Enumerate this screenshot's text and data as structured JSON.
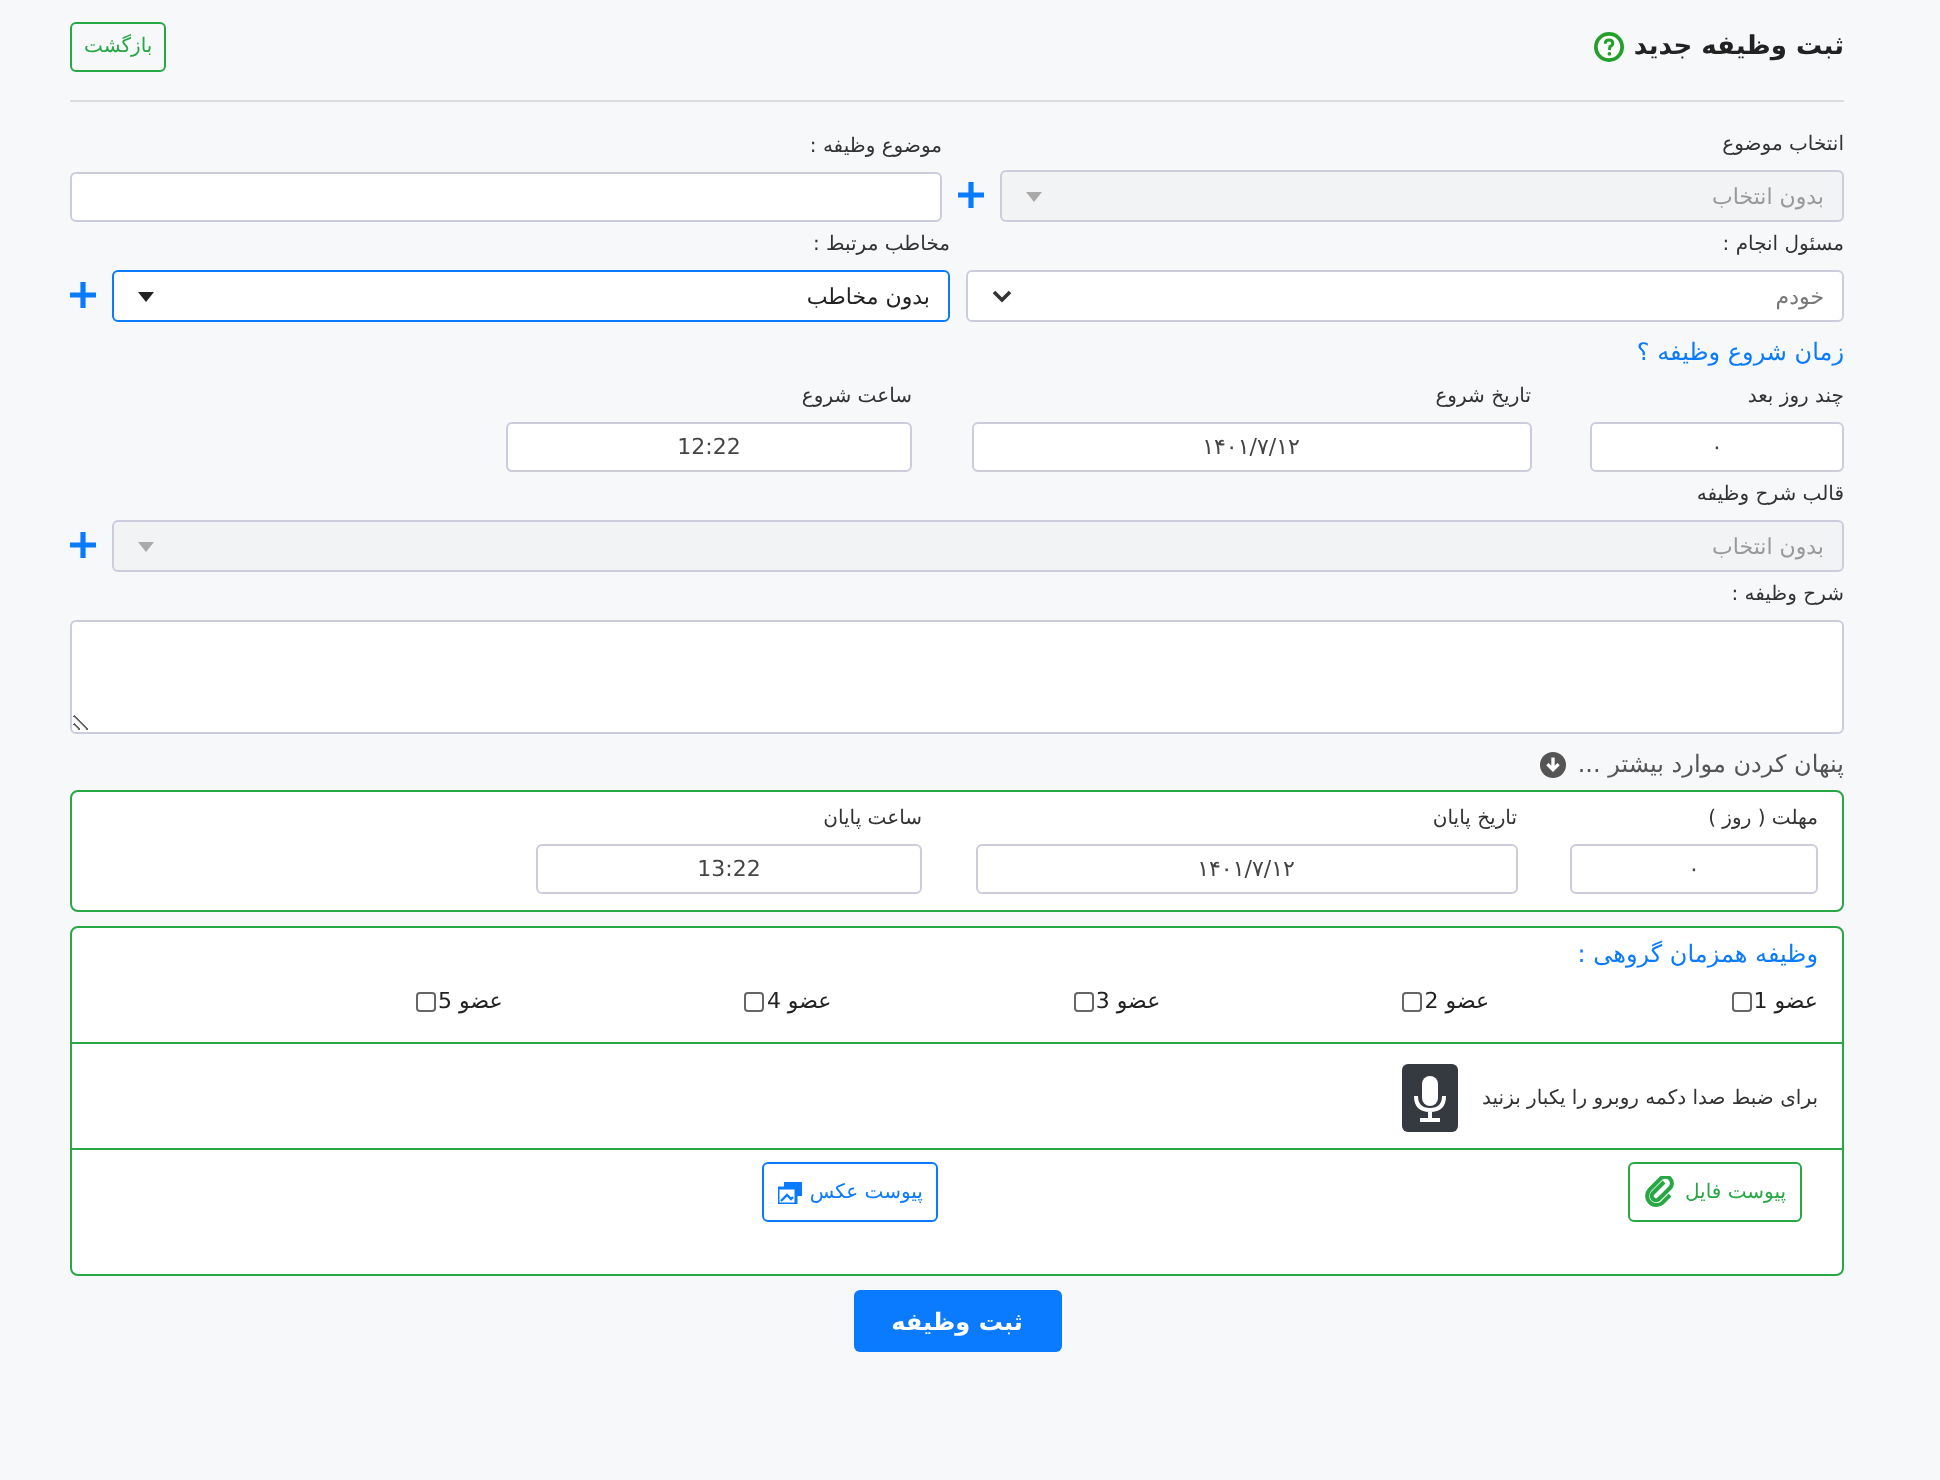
{
  "header": {
    "title": "ثبت وظیفه جدید",
    "back_button": "بازگشت"
  },
  "subject_select": {
    "label": "انتخاب موضوع",
    "value": "بدون انتخاب",
    "disabled": true
  },
  "subject_field": {
    "label": "موضوع وظیفه :"
  },
  "assignee_select": {
    "label": "مسئول انجام :",
    "value": "خودم"
  },
  "contact_select": {
    "label": "مخاطب مرتبط :",
    "value": "بدون مخاطب",
    "focused": true
  },
  "start_heading": "زمان شروع وظیفه ؟",
  "start_fields": [
    {
      "label": "چند روز بعد",
      "value": "۰",
      "kind": "days"
    },
    {
      "label": "تاریخ شروع",
      "value": "۱۴۰۱/۷/۱۲",
      "kind": "date"
    },
    {
      "label": "ساعت شروع",
      "value": "12:22",
      "kind": "time"
    }
  ],
  "template_select": {
    "label": "قالب شرح وظیفه",
    "value": "بدون انتخاب",
    "disabled": true
  },
  "description": {
    "label": "شرح وظیفه :"
  },
  "toggle_more": "پنهان کردن موارد بیشتر ...",
  "end_fields": [
    {
      "label": "مهلت ( روز )",
      "value": "۰",
      "kind": "days"
    },
    {
      "label": "تاریخ پایان",
      "value": "۱۴۰۱/۷/۱۲",
      "kind": "date"
    },
    {
      "label": "ساعت پایان",
      "value": "13:22",
      "kind": "time"
    }
  ],
  "group": {
    "title": "وظیفه همزمان گروهی :",
    "members": [
      {
        "label": "عضو 1",
        "checked": false
      },
      {
        "label": "عضو 2",
        "checked": false
      },
      {
        "label": "عضو 3",
        "checked": false
      },
      {
        "label": "عضو 4",
        "checked": false
      },
      {
        "label": "عضو 5",
        "checked": false
      }
    ],
    "record_hint": "برای ضبط صدا دکمه روبرو را یکبار بزنید",
    "attach_file": "پیوست فایل",
    "attach_image": "پیوست عکس"
  },
  "submit": "ثبت وظیفه"
}
